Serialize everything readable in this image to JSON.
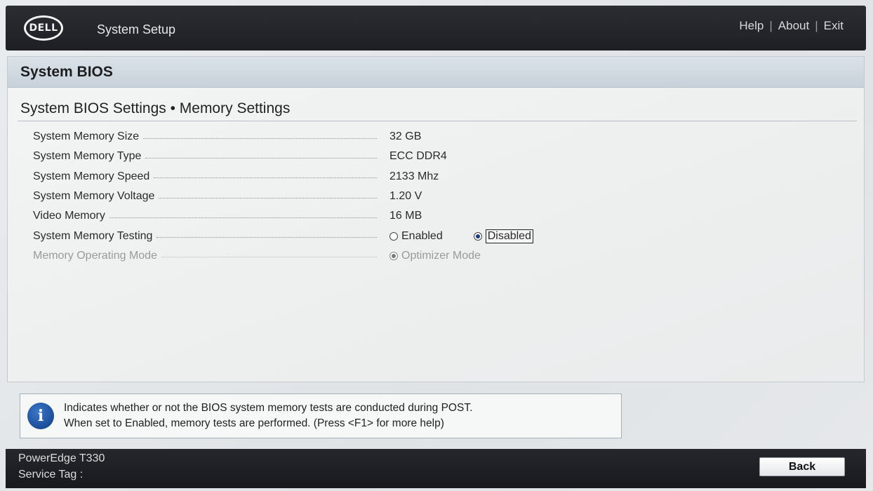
{
  "header": {
    "logo_text": "DELL",
    "app_title": "System Setup",
    "links": {
      "help": "Help",
      "about": "About",
      "exit": "Exit",
      "separator": "|"
    }
  },
  "panel": {
    "title": "System BIOS",
    "breadcrumb": "System BIOS Settings • Memory Settings",
    "rows": [
      {
        "label": "System Memory Size",
        "value": "32 GB"
      },
      {
        "label": "System Memory Type",
        "value": "ECC DDR4"
      },
      {
        "label": "System Memory Speed",
        "value": "2133 Mhz"
      },
      {
        "label": "System Memory Voltage",
        "value": "1.20 V"
      },
      {
        "label": "Video Memory",
        "value": "16 MB"
      },
      {
        "label": "System Memory Testing",
        "options": [
          "Enabled",
          "Disabled"
        ],
        "selected": "Disabled"
      },
      {
        "label": "Memory Operating Mode",
        "options": [
          "Optimizer Mode"
        ],
        "selected": "Optimizer Mode",
        "disabled": true
      }
    ]
  },
  "help": {
    "line1": "Indicates whether or not the BIOS system memory tests are conducted during POST.",
    "line2": "When set to Enabled, memory tests are performed. (Press <F1> for more help)"
  },
  "footer": {
    "model": "PowerEdge T330",
    "service_tag_label": "Service Tag :",
    "back_label": "Back"
  },
  "icons": {
    "info": "info-icon",
    "radio": "radio-icon"
  },
  "colors": {
    "accent": "#1b3a8c",
    "topbar": "#1e1f25",
    "panel_header": "#c7d1d9"
  }
}
